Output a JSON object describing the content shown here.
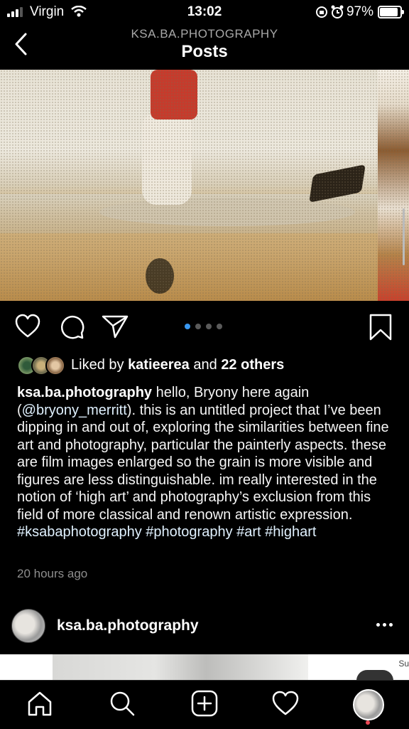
{
  "status": {
    "carrier": "Virgin",
    "time": "13:02",
    "battery": "97%",
    "battery_level": 0.97
  },
  "header": {
    "account": "KSA.BA.PHOTOGRAPHY",
    "title": "Posts"
  },
  "post": {
    "carousel": {
      "count": 4,
      "active_index": 0
    },
    "likes": {
      "prefix": "Liked by",
      "user": "katieerea",
      "joiner": "and",
      "others": "22 others"
    },
    "caption": {
      "username": "ksa.ba.photography",
      "text_1": "hello, Bryony here again (",
      "mention": "@bryony_merritt",
      "text_2": "). this is an untitled project that I’ve been dipping in and out of, exploring the similarities between fine art and photography, particular the painterly aspects. these are film images enlarged so the grain is more visible and figures are less distinguishable. im really interested in the notion of ‘high art’ and photography’s exclusion from this field of more classical and renown artistic expression.",
      "hashtags": "#ksabaphotography #photography #art #highart"
    },
    "time_ago": "20 hours ago"
  },
  "next_post": {
    "username": "ksa.ba.photography",
    "preview_text": "Su"
  },
  "colors": {
    "accent": "#3897f0",
    "dot": "#5a5a5a",
    "notification": "#ed4956"
  },
  "icons": {
    "back": "chevron-left-icon",
    "like": "heart-icon",
    "comment": "comment-icon",
    "share": "paper-plane-icon",
    "save": "bookmark-icon",
    "more": "ellipsis-icon",
    "home": "home-icon",
    "search": "search-icon",
    "create": "plus-square-icon",
    "activity": "heart-outline-icon",
    "profile": "avatar"
  }
}
